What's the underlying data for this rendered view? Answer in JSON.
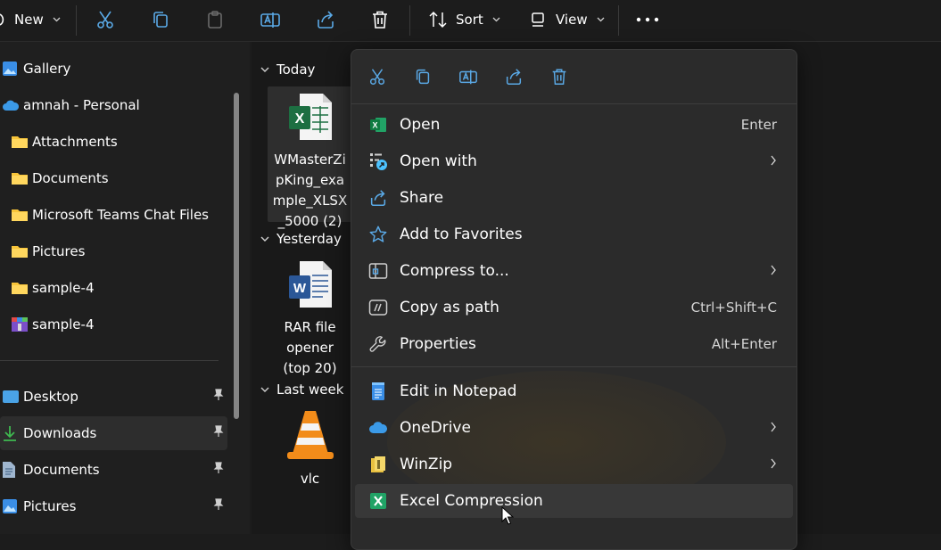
{
  "toolbar": {
    "new_label": "New",
    "sort_label": "Sort",
    "view_label": "View"
  },
  "sidebar": {
    "items": [
      {
        "label": "Gallery"
      },
      {
        "label": "amnah - Personal"
      },
      {
        "label": "Attachments"
      },
      {
        "label": "Documents"
      },
      {
        "label": "Microsoft Teams Chat Files"
      },
      {
        "label": "Pictures"
      },
      {
        "label": "sample-4"
      },
      {
        "label": "sample-4"
      }
    ],
    "pinned": [
      {
        "label": "Desktop"
      },
      {
        "label": "Downloads"
      },
      {
        "label": "Documents"
      },
      {
        "label": "Pictures"
      }
    ]
  },
  "files": {
    "groups": [
      {
        "label": "Today"
      },
      {
        "label": "Yesterday"
      },
      {
        "label": "Last week"
      }
    ],
    "items": [
      {
        "lines": [
          "WMasterZi",
          "pKing_exa",
          "mple_XLSX",
          "_5000 (2)"
        ]
      },
      {
        "lines": [
          "RAR file",
          "opener",
          "(top 20)"
        ]
      },
      {
        "lines": [
          "vlc"
        ]
      }
    ]
  },
  "context_menu": {
    "items": [
      {
        "label": "Open",
        "shortcut": "Enter"
      },
      {
        "label": "Open with"
      },
      {
        "label": "Share"
      },
      {
        "label": "Add to Favorites"
      },
      {
        "label": "Compress to..."
      },
      {
        "label": "Copy as path",
        "shortcut": "Ctrl+Shift+C"
      },
      {
        "label": "Properties",
        "shortcut": "Alt+Enter"
      },
      {
        "label": "Edit in Notepad"
      },
      {
        "label": "OneDrive"
      },
      {
        "label": "WinZip"
      },
      {
        "label": "Excel Compression"
      }
    ]
  },
  "colors": {
    "background": "#1c1c1c",
    "menu_bg": "#2b2b2b",
    "accent_blue": "#4cc2ff",
    "excel_green": "#1d6f42",
    "folder_yellow": "#f8c53a",
    "word_blue": "#2b5797",
    "vlc_orange": "#f28c1a"
  }
}
